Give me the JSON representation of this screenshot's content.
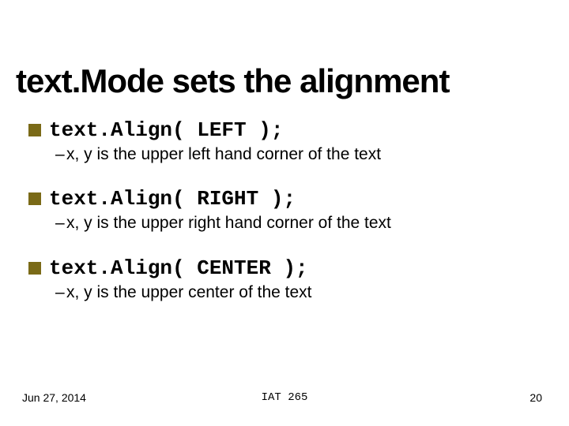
{
  "title": "text.Mode sets the alignment",
  "items": [
    {
      "code": "text.Align( LEFT );",
      "desc": "x, y is the upper left hand corner of the text"
    },
    {
      "code": "text.Align( RIGHT );",
      "desc": "x, y is the upper right hand corner of the text"
    },
    {
      "code": "text.Align( CENTER );",
      "desc": "x, y is the upper center of the text"
    }
  ],
  "sub_bullet_prefix": "– ",
  "footer": {
    "date": "Jun 27, 2014",
    "course": "IAT 265",
    "page": "20"
  }
}
